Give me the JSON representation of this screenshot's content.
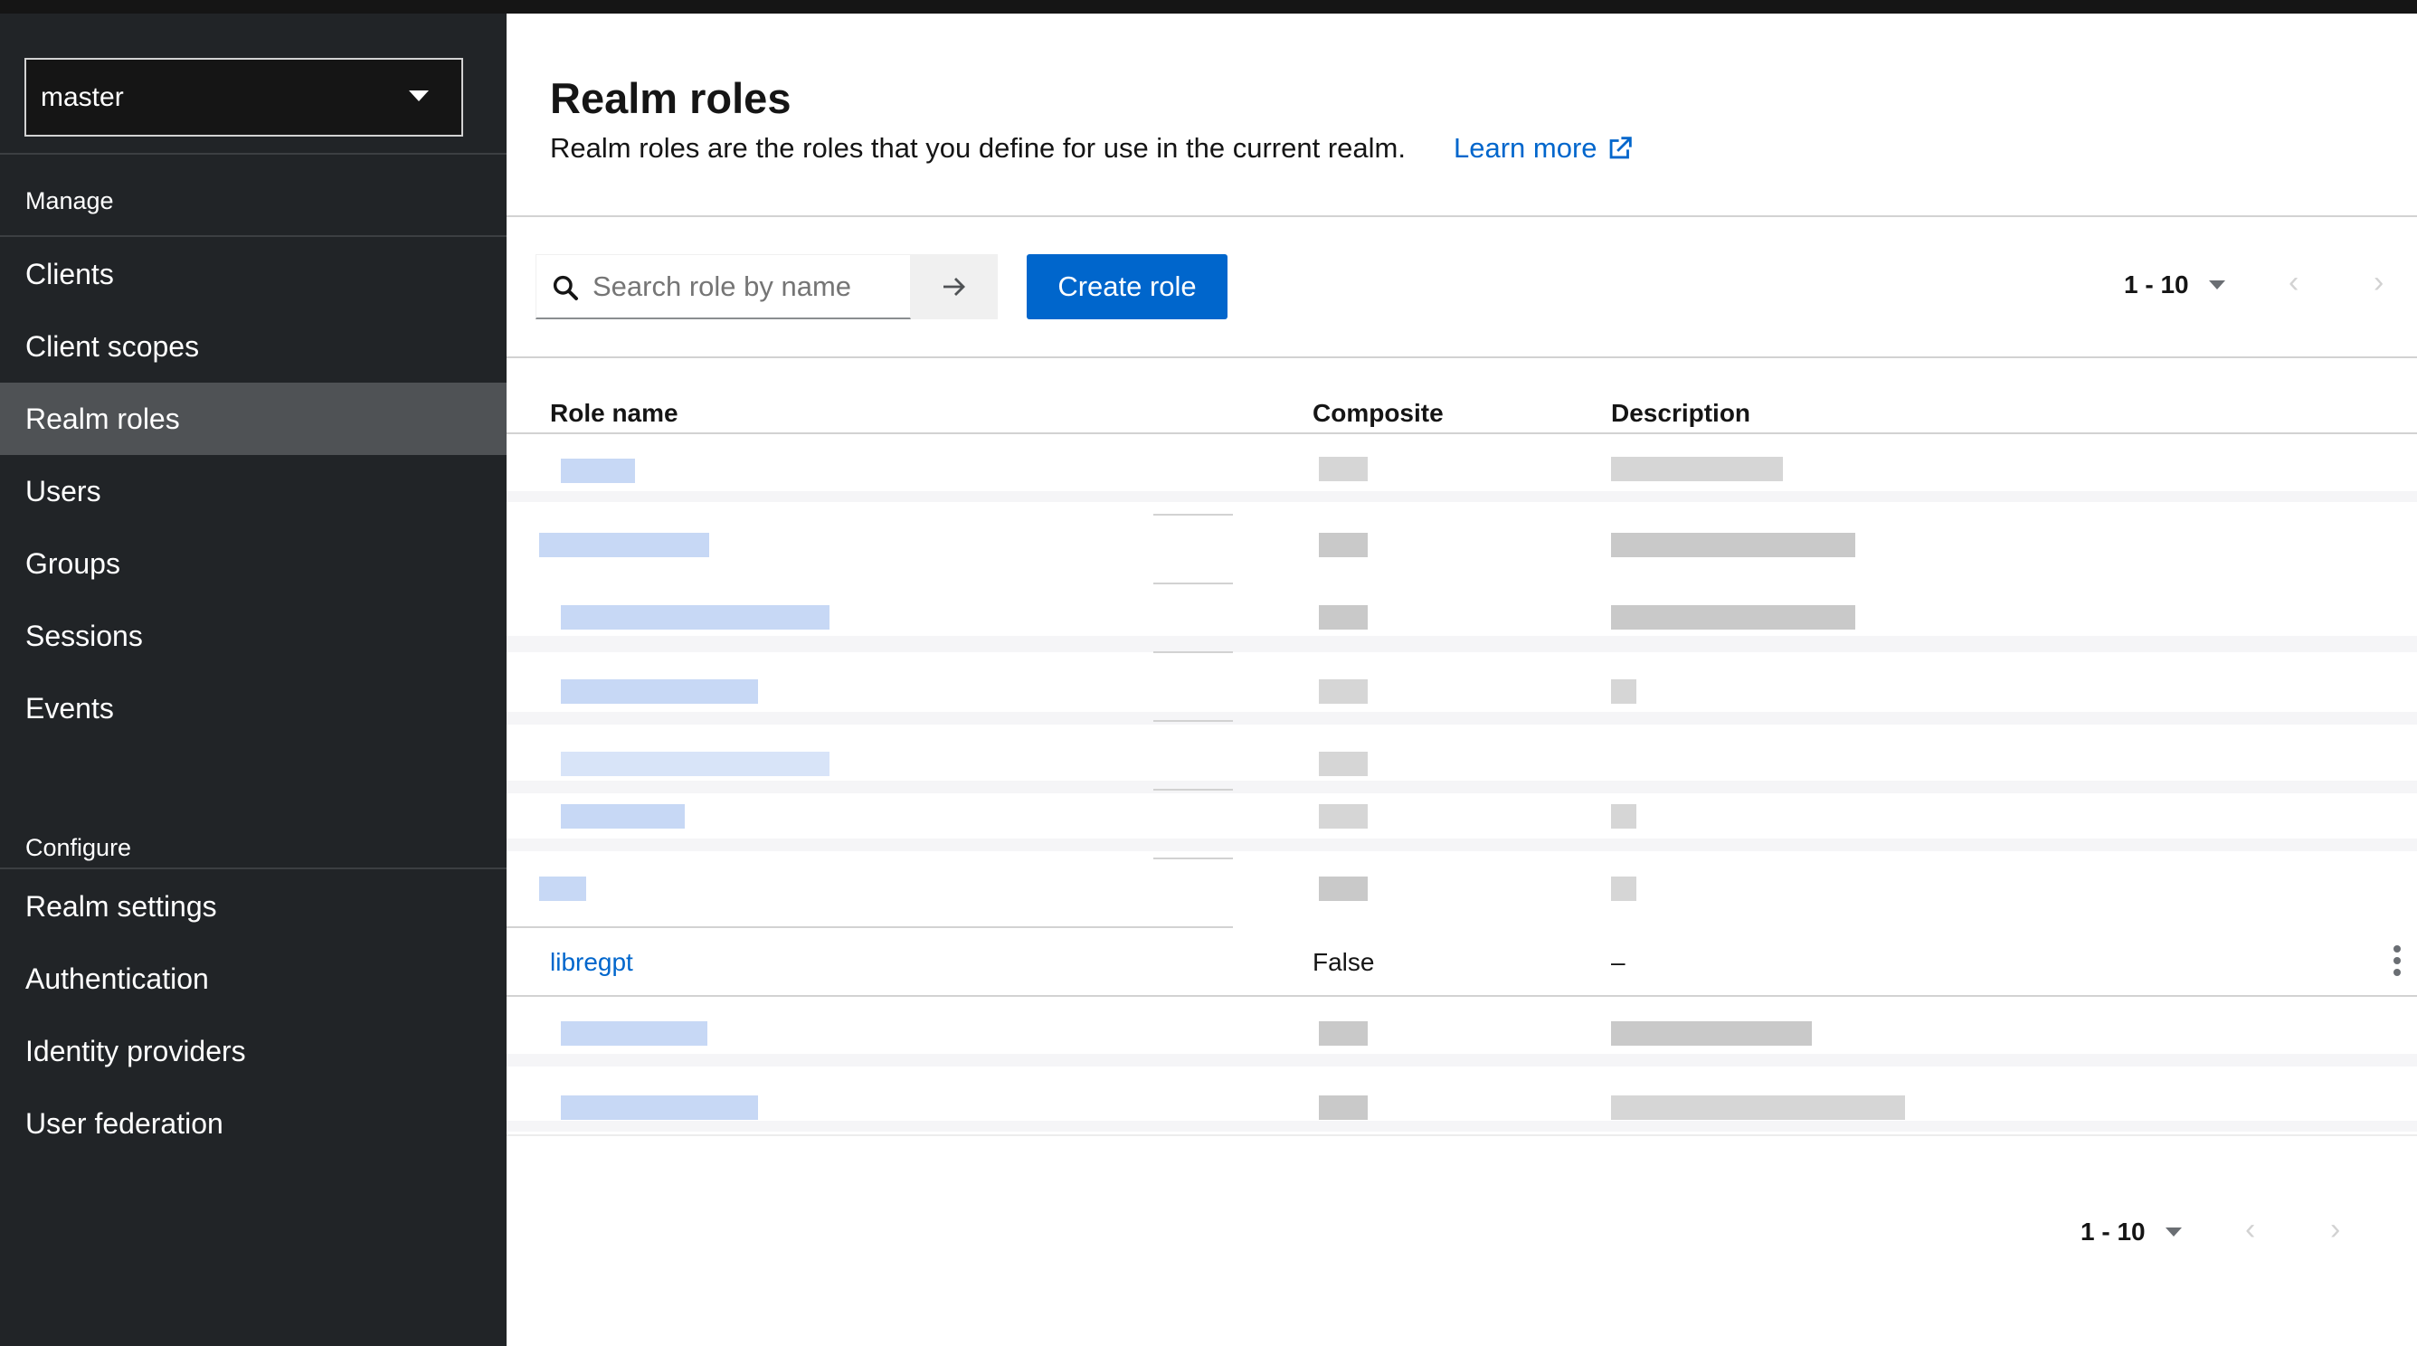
{
  "realm_selector": {
    "value": "master"
  },
  "sidebar": {
    "sections": [
      {
        "title": "Manage",
        "items": [
          "Clients",
          "Client scopes",
          "Realm roles",
          "Users",
          "Groups",
          "Sessions",
          "Events"
        ]
      },
      {
        "title": "Configure",
        "items": [
          "Realm settings",
          "Authentication",
          "Identity providers",
          "User federation"
        ]
      }
    ],
    "active_item": "Realm roles"
  },
  "header": {
    "title": "Realm roles",
    "description": "Realm roles are the roles that you define for use in the current realm.",
    "learn_more": "Learn more"
  },
  "toolbar": {
    "search_placeholder": "Search role by name",
    "create_label": "Create role",
    "pagination_label": "1 - 10"
  },
  "table": {
    "columns": [
      "Role name",
      "Composite",
      "Description"
    ],
    "visible_row": {
      "name": "libregpt",
      "composite": "False",
      "description": "–"
    }
  },
  "footer": {
    "pagination_label": "1 - 10"
  },
  "colors": {
    "sidebar_bg": "#212427",
    "accent": "#0066cc",
    "active_nav": "#4f5255"
  }
}
